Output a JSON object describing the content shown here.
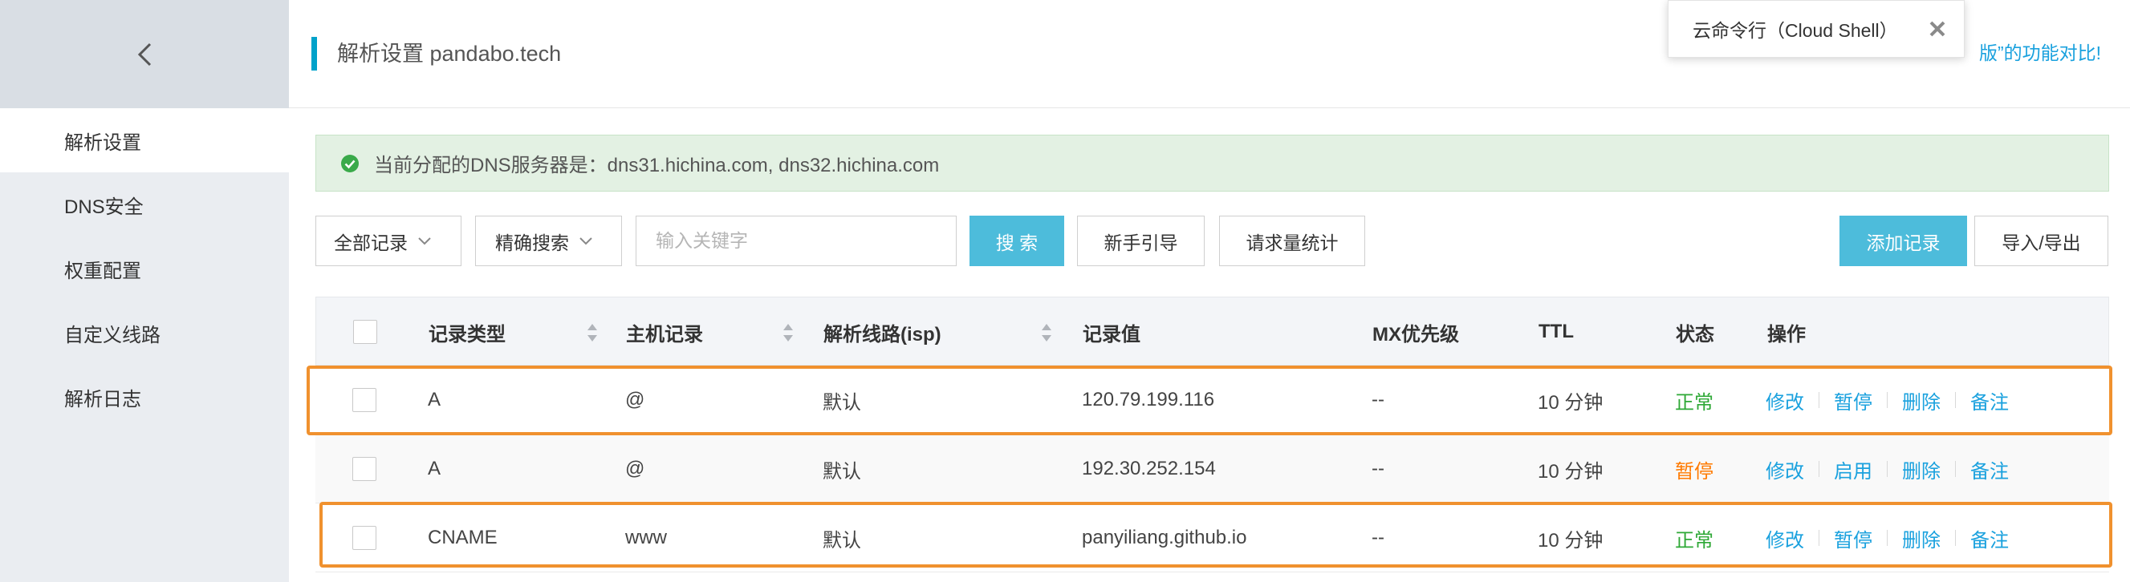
{
  "sidebar": {
    "items": [
      {
        "label": "解析设置",
        "active": true
      },
      {
        "label": "DNS安全"
      },
      {
        "label": "权重配置"
      },
      {
        "label": "自定义线路"
      },
      {
        "label": "解析日志"
      }
    ]
  },
  "header": {
    "title": "解析设置 pandabo.tech",
    "compare_link": "版”的功能对比!"
  },
  "shell_popup": {
    "label": "云命令行（Cloud Shell）"
  },
  "notice": {
    "text": "当前分配的DNS服务器是：dns31.hichina.com, dns32.hichina.com"
  },
  "toolbar": {
    "record_filter": "全部记录",
    "search_mode": "精确搜索",
    "search_placeholder": "输入关键字",
    "search_button": "搜 索",
    "guide_button": "新手引导",
    "stats_button": "请求量统计",
    "add_button": "添加记录",
    "import_export_button": "导入/导出"
  },
  "table": {
    "columns": [
      "记录类型",
      "主机记录",
      "解析线路(isp)",
      "记录值",
      "MX优先级",
      "TTL",
      "状态",
      "操作"
    ],
    "rows": [
      {
        "type": "A",
        "host": "@",
        "line": "默认",
        "value": "120.79.199.116",
        "mx": "--",
        "ttl": "10 分钟",
        "status": "正常",
        "status_kind": "ok",
        "ops": [
          "修改",
          "暂停",
          "删除",
          "备注"
        ]
      },
      {
        "type": "A",
        "host": "@",
        "line": "默认",
        "value": "192.30.252.154",
        "mx": "--",
        "ttl": "10 分钟",
        "status": "暂停",
        "status_kind": "paused",
        "ops": [
          "修改",
          "启用",
          "删除",
          "备注"
        ]
      },
      {
        "type": "CNAME",
        "host": "www",
        "line": "默认",
        "value": "panyiliang.github.io",
        "mx": "--",
        "ttl": "10 分钟",
        "status": "正常",
        "status_kind": "ok",
        "ops": [
          "修改",
          "暂停",
          "删除",
          "备注"
        ]
      }
    ]
  },
  "colors": {
    "accent": "#1aa1de",
    "primary_button": "#4dbcdb",
    "status_ok": "#2ea836",
    "status_paused": "#ff7a00",
    "highlight": "#f0912e"
  },
  "icons": {
    "back": "chevron-left-icon",
    "close": "close-icon",
    "notice": "check-circle-icon",
    "dropdown": "chevron-down-icon",
    "sort": "sort-icon"
  }
}
